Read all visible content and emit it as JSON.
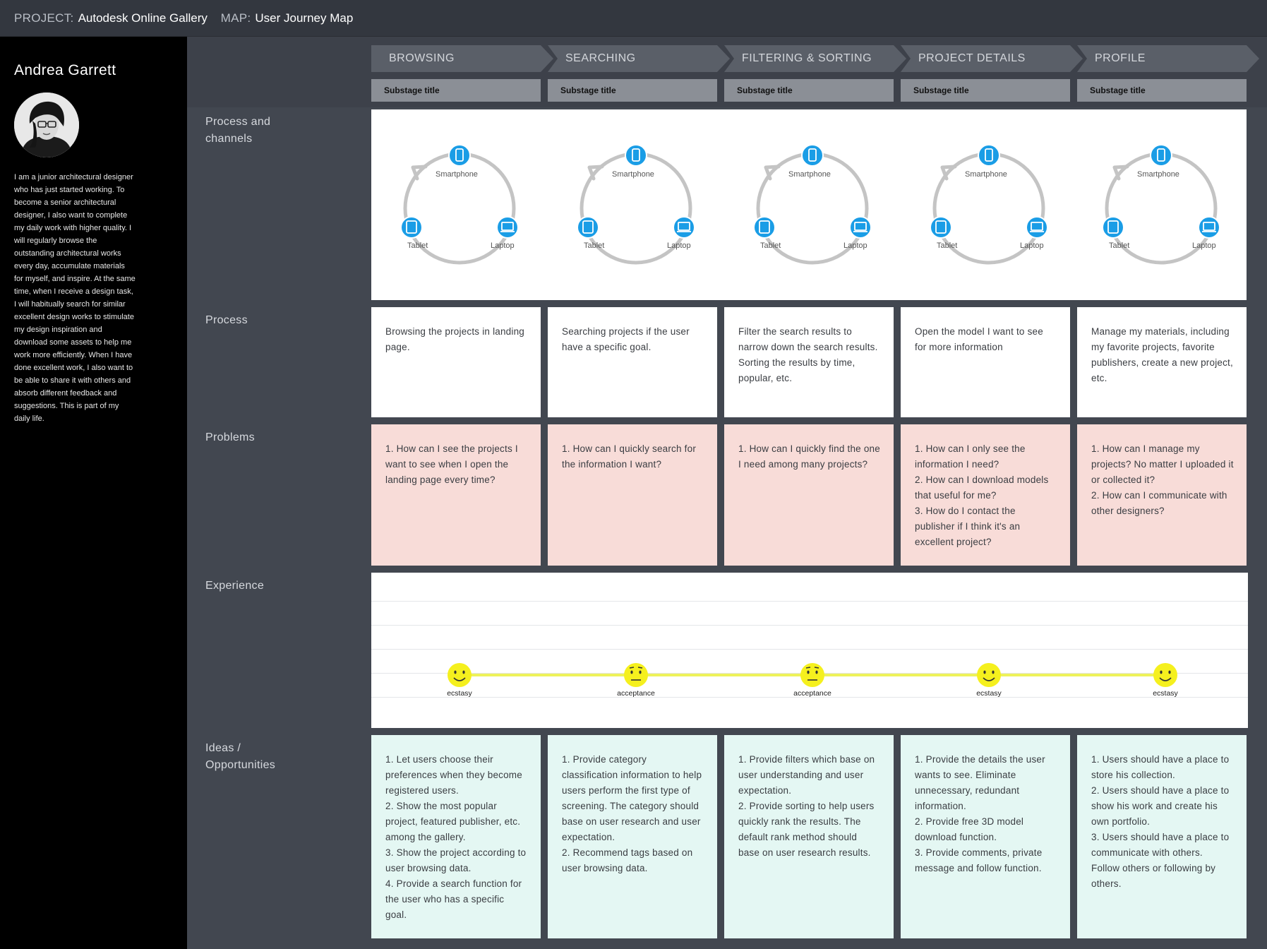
{
  "header": {
    "project_label": "PROJECT:",
    "project_value": "Autodesk Online Gallery",
    "map_label": "MAP:",
    "map_value": "User Journey Map"
  },
  "persona": {
    "name": "Andrea Garrett",
    "bio": "I am a junior architectural designer who has just started working. To become a senior architectural designer, I also want to complete my daily work with higher quality. I will regularly browse the outstanding architectural works every day, accumulate materials for myself, and inspire. At the same time, when I receive a design task, I will habitually search for similar excellent design works to stimulate my design inspiration and download some assets to help me work more efficiently. When I have done excellent work, I also want to be able to share it with others and absorb different feedback and suggestions. This is part of my daily life."
  },
  "stages": [
    {
      "title": "BROWSING",
      "substage": "Substage title"
    },
    {
      "title": "SEARCHING",
      "substage": "Substage title"
    },
    {
      "title": "FILTERING & SORTING",
      "substage": "Substage title"
    },
    {
      "title": "PROJECT DETAILS",
      "substage": "Substage title"
    },
    {
      "title": "PROFILE",
      "substage": "Substage title"
    }
  ],
  "row_labels": {
    "channels": "Process and channels",
    "process": "Process",
    "problems": "Problems",
    "experience": "Experience",
    "ideas": "Ideas / Opportunities"
  },
  "channels": {
    "smartphone": "Smartphone",
    "tablet": "Tablet",
    "laptop": "Laptop"
  },
  "process": [
    "Browsing the projects in landing page.",
    "Searching projects if the  user have a specific goal.",
    "Filter the search results to narrow down the search results.\nSorting the results by time, popular, etc.",
    "Open the model I want to see for more information",
    "Manage my materials, including my favorite projects, favorite publishers, create a new project, etc."
  ],
  "problems": [
    "1. How can I see the projects I want to see when I open the landing page every time?",
    "1. How can I quickly search for the information I want?",
    "1. How can I quickly find the one I need among many projects?",
    "1. How can I only see the information I need?\n2. How can I download models that useful for me?\n3. How do I contact the publisher if I think it's an excellent project?",
    "1. How can I manage my projects? No matter I uploaded it or collected it?\n2. How can I communicate with other designers?"
  ],
  "experience": [
    {
      "emotion": "ecstasy",
      "level": 1,
      "face": "smile"
    },
    {
      "emotion": "acceptance",
      "level": 1,
      "face": "neutral"
    },
    {
      "emotion": "acceptance",
      "level": 1,
      "face": "neutral"
    },
    {
      "emotion": "ecstasy",
      "level": 1,
      "face": "smile"
    },
    {
      "emotion": "ecstasy",
      "level": 1,
      "face": "smile"
    }
  ],
  "ideas": [
    "1. Let users choose their preferences when they become registered users.\n2. Show the most popular project, featured publisher, etc. among the gallery.\n3. Show the project according to user browsing data.\n4. Provide a search function for the user who has a specific goal.",
    "1. Provide category classification information to help users perform the first type of screening. The category should base on user research and user expectation.\n2. Recommend tags based on user browsing data.",
    "1. Provide filters which base on user understanding and user expectation.\n2. Provide sorting to help users quickly rank the results. The default rank method should base on user research results.",
    "1. Provide the details the user wants to see. Eliminate unnecessary, redundant information.\n2. Provide free 3D model download function.\n3. Provide comments, private message and follow function.",
    "1. Users should have a place to store his collection.\n2. Users should have a place to show his work and create his own portfolio.\n3. Users should have a place to communicate with others. Follow others or following by others."
  ],
  "colors": {
    "background": "#424750",
    "sidebar": "#000000",
    "stage_arrow": "#5a5f68",
    "substage": "#8b8f96",
    "problem_card": "#f8dcd8",
    "idea_card": "#e4f7f3",
    "device_icon": "#1a9de6",
    "emotion_face": "#f5f01e"
  }
}
